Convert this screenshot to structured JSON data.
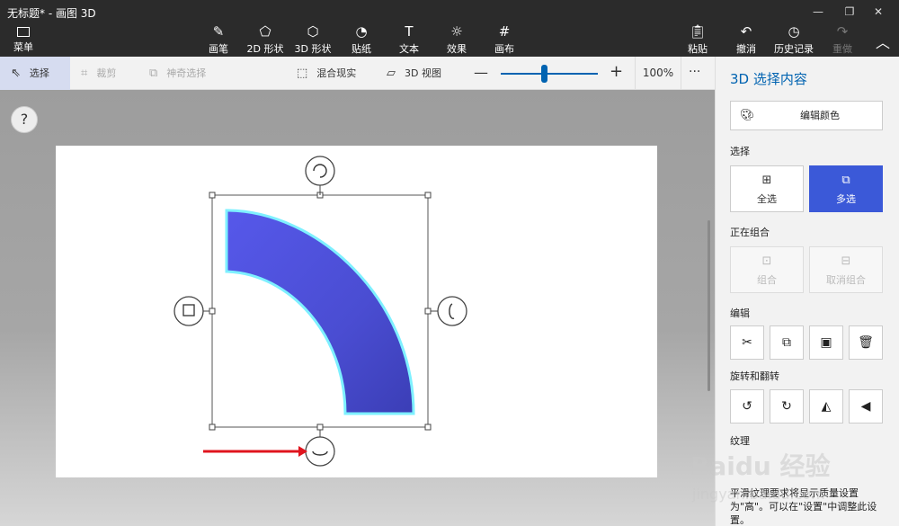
{
  "window": {
    "title": "无标题* - 画图 3D",
    "minimize": "—",
    "restore": "❐",
    "close": "✕"
  },
  "topbar": {
    "menu_label": "菜单",
    "tools": [
      {
        "label": "画笔",
        "icon": "brush-icon",
        "glyph": "✎"
      },
      {
        "label": "2D 形状",
        "icon": "2d-shapes-icon",
        "glyph": "⬠"
      },
      {
        "label": "3D 形状",
        "icon": "3d-shapes-icon",
        "glyph": "⬡"
      },
      {
        "label": "贴纸",
        "icon": "sticker-icon",
        "glyph": "◔"
      },
      {
        "label": "文本",
        "icon": "text-icon",
        "glyph": "T"
      },
      {
        "label": "效果",
        "icon": "effects-icon",
        "glyph": "☼"
      },
      {
        "label": "画布",
        "icon": "canvas-icon",
        "glyph": "#"
      }
    ],
    "paste_label": "粘贴",
    "undo_label": "撤消",
    "history_label": "历史记录",
    "redo_label": "重做",
    "collapse_glyph": "︿"
  },
  "subbar": {
    "select_label": "选择",
    "crop_label": "裁剪",
    "magic_select_label": "神奇选择",
    "mixed_reality_label": "混合现实",
    "view3d_label": "3D 视图",
    "zoom_minus": "—",
    "zoom_plus": "+",
    "zoom_value": "100%",
    "zoom_level_percent": 45,
    "more": "···"
  },
  "canvas": {
    "help": "?",
    "shape_colors": {
      "fill": "#4b4fd6",
      "fill_light": "#6a6ef0",
      "glow": "#7ef0ff",
      "arrow": "#e0141e"
    }
  },
  "panel": {
    "title": "3D 选择内容",
    "edit_color_label": "编辑颜色",
    "select_section": "选择",
    "select_all_label": "全选",
    "multi_select_label": "多选",
    "group_section": "正在组合",
    "group_label": "组合",
    "ungroup_label": "取消组合",
    "edit_section": "编辑",
    "rotate_section": "旋转和翻转",
    "texture_section": "纹理",
    "texture_note": "平滑纹理要求将显示质量设置为\"高\"。可以在\"设置\"中调整此设置。",
    "accent": "#3b59d8"
  },
  "watermark": {
    "text": "Baidu 经验",
    "sub": "jingyan.baidu.com"
  }
}
